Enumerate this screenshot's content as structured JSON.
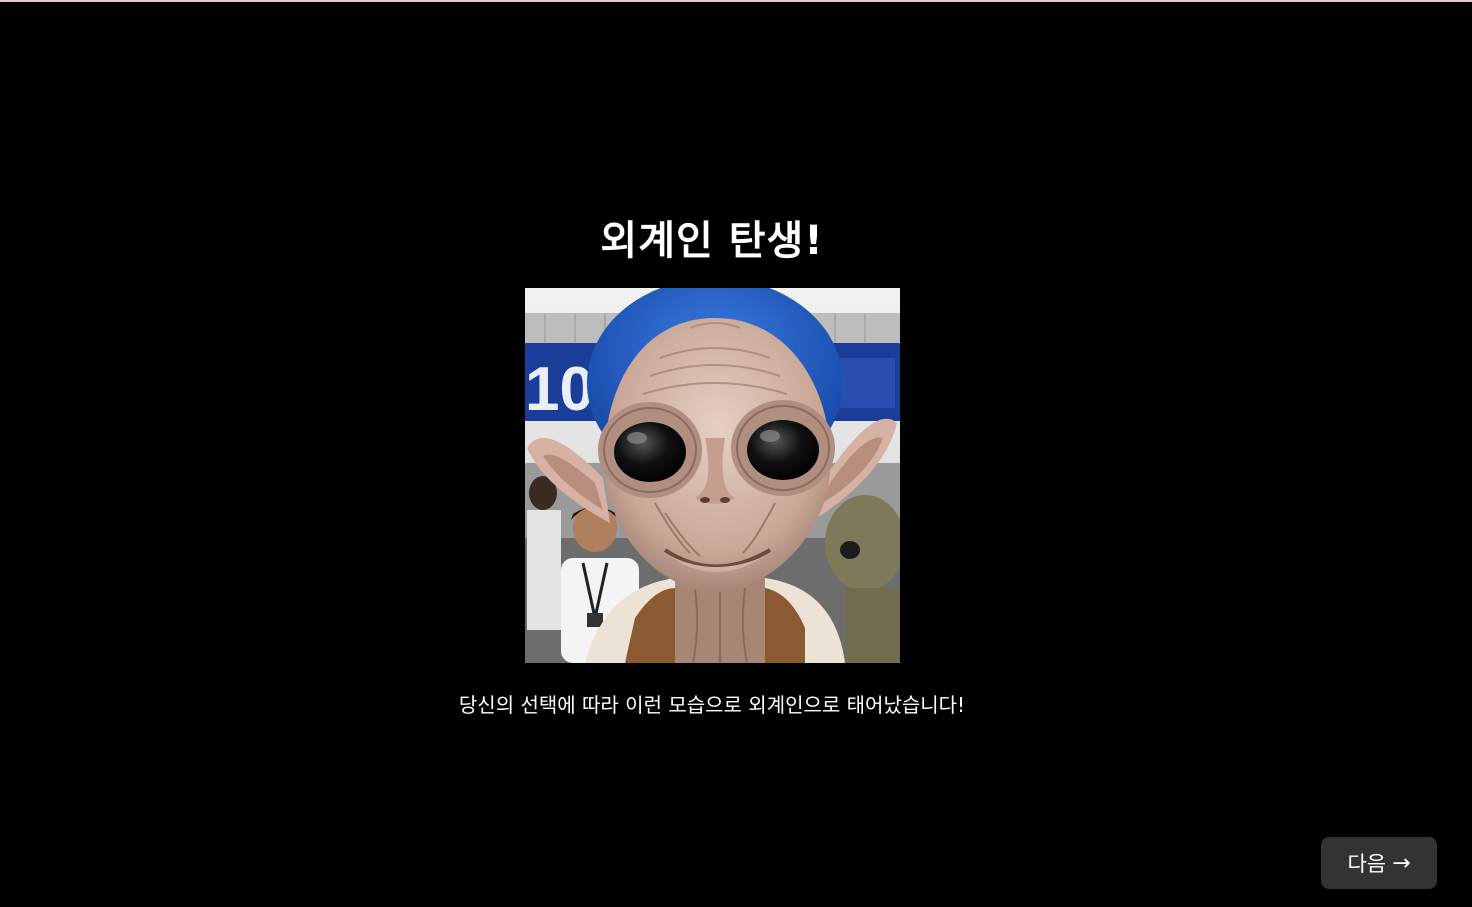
{
  "page": {
    "title": "외계인 탄생!",
    "caption": "당신의 선택에 따라 이런 모습으로 외계인으로 태어났습니다!",
    "next_label": "다음",
    "next_icon": "arrow-right-icon",
    "next_icon_glyph": "→"
  },
  "image": {
    "alt": "alien image",
    "sign_text": "10:"
  },
  "colors": {
    "background": "#000000",
    "text": "#ffffff",
    "button_bg": "#333333",
    "top_line": "#e8c9c9"
  }
}
